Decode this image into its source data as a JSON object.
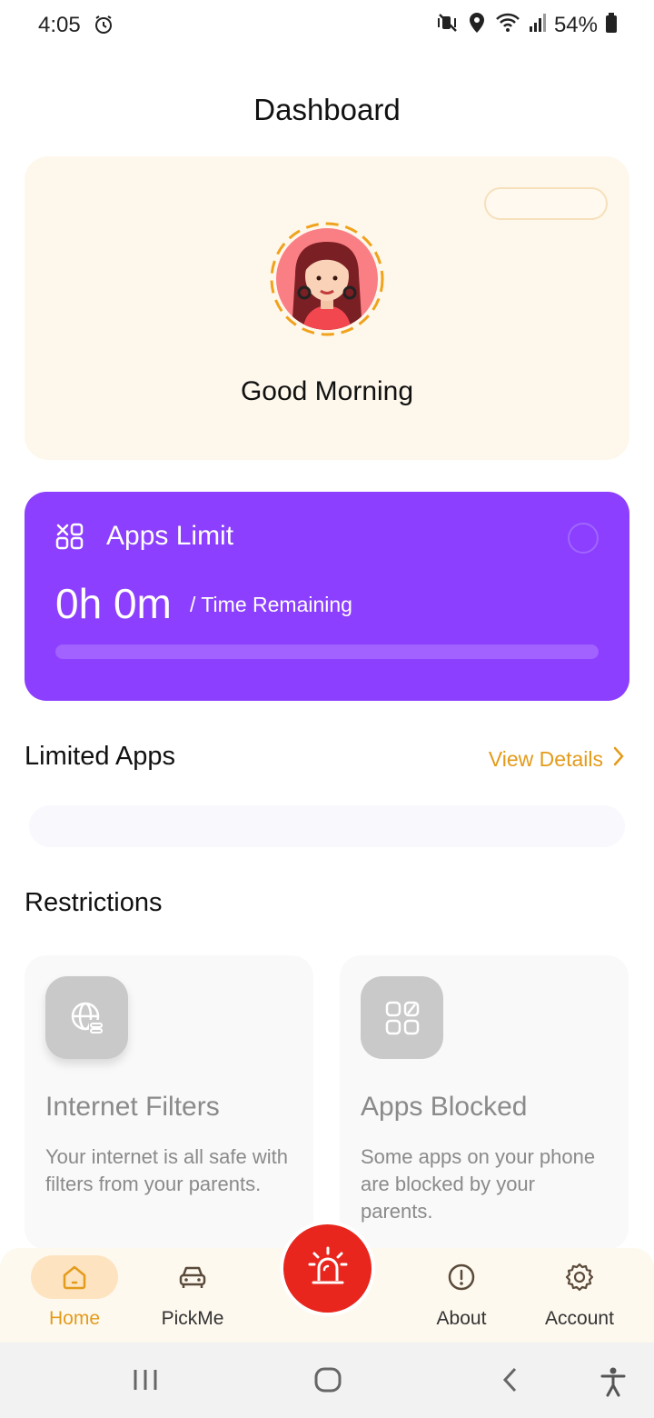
{
  "status_bar": {
    "time": "4:05",
    "battery": "54%",
    "icons": [
      "alarm-icon",
      "mute-vibrate-icon",
      "location-icon",
      "wifi-icon",
      "signal-icon",
      "battery-icon"
    ]
  },
  "header": {
    "title": "Dashboard"
  },
  "greeting": {
    "text": "Good Morning",
    "avatar": "girl-avatar"
  },
  "apps_limit": {
    "title": "Apps Limit",
    "time": "0h 0m",
    "subtitle": "/ Time Remaining",
    "progress": 0
  },
  "limited_apps": {
    "title": "Limited Apps",
    "link": "View Details"
  },
  "restrictions": {
    "title": "Restrictions",
    "cards": [
      {
        "title": "Internet Filters",
        "desc": "Your internet is all safe with filters from your parents.",
        "icon": "globe-filter-icon"
      },
      {
        "title": "Apps Blocked",
        "desc": "Some apps on your phone are blocked by your parents.",
        "icon": "apps-grid-icon"
      }
    ]
  },
  "bottom_nav": {
    "items": [
      {
        "label": "Home",
        "icon": "home-icon"
      },
      {
        "label": "PickMe",
        "icon": "car-icon"
      },
      {
        "label": "About",
        "icon": "info-icon"
      },
      {
        "label": "Account",
        "icon": "gear-icon"
      }
    ],
    "sos_icon": "siren-icon"
  },
  "colors": {
    "accent": "#e39b1b",
    "purple": "#8c3ffe",
    "sos": "#e8261d",
    "cream": "#fef8ec"
  }
}
